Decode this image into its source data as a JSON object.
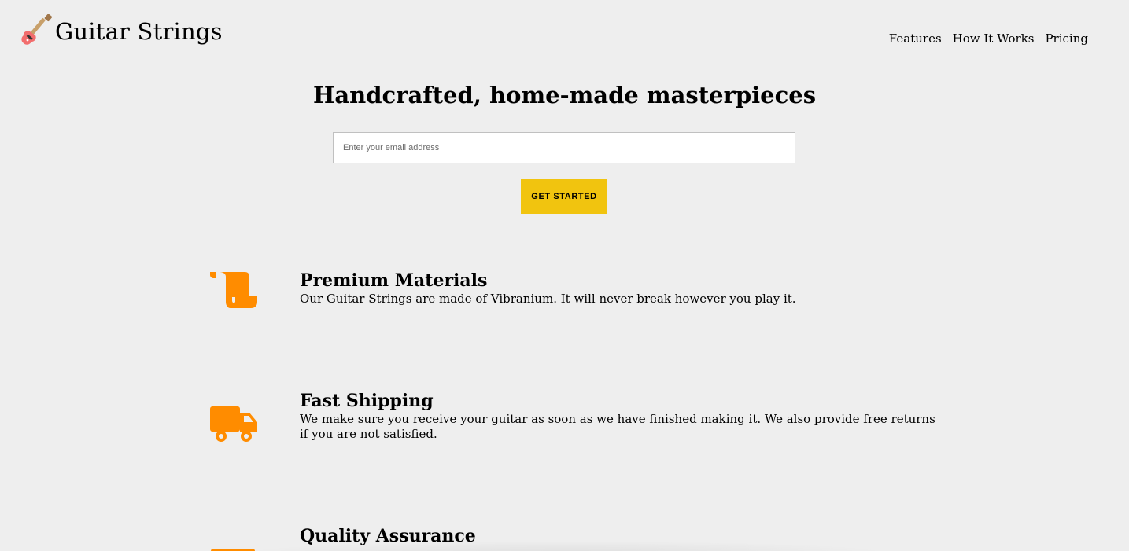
{
  "header": {
    "brand": "Guitar Strings",
    "logo_icon": "guitar-icon",
    "nav": [
      "Features",
      "How It Works",
      "Pricing"
    ]
  },
  "hero": {
    "title": "Handcrafted, home-made masterpieces",
    "email_placeholder": "Enter your email address",
    "cta_label": "GET STARTED"
  },
  "features": [
    {
      "icon": "scroll-icon",
      "title": "Premium Materials",
      "description": "Our Guitar Strings are made of Vibranium. It will never break however you play it."
    },
    {
      "icon": "truck-icon",
      "title": "Fast Shipping",
      "description": "We make sure you receive your guitar as soon as we have finished making it. We also provide free returns if you are not satisfied."
    },
    {
      "icon": "check-icon",
      "title": "Quality Assurance",
      "description": ""
    }
  ],
  "colors": {
    "background": "#eeeeee",
    "accent": "#f1c40f",
    "icon": "#ff8c00"
  }
}
